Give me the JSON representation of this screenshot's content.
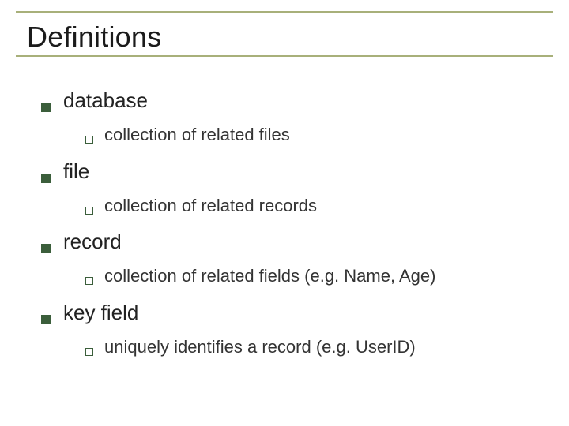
{
  "title": "Definitions",
  "terms": [
    {
      "label": "database",
      "definition": "collection of related files"
    },
    {
      "label": "file",
      "definition": "collection of related records"
    },
    {
      "label": "record",
      "definition": "collection of related fields (e.g. Name, Age)"
    },
    {
      "label": "key field",
      "definition": "uniquely identifies a record (e.g. UserID)"
    }
  ]
}
